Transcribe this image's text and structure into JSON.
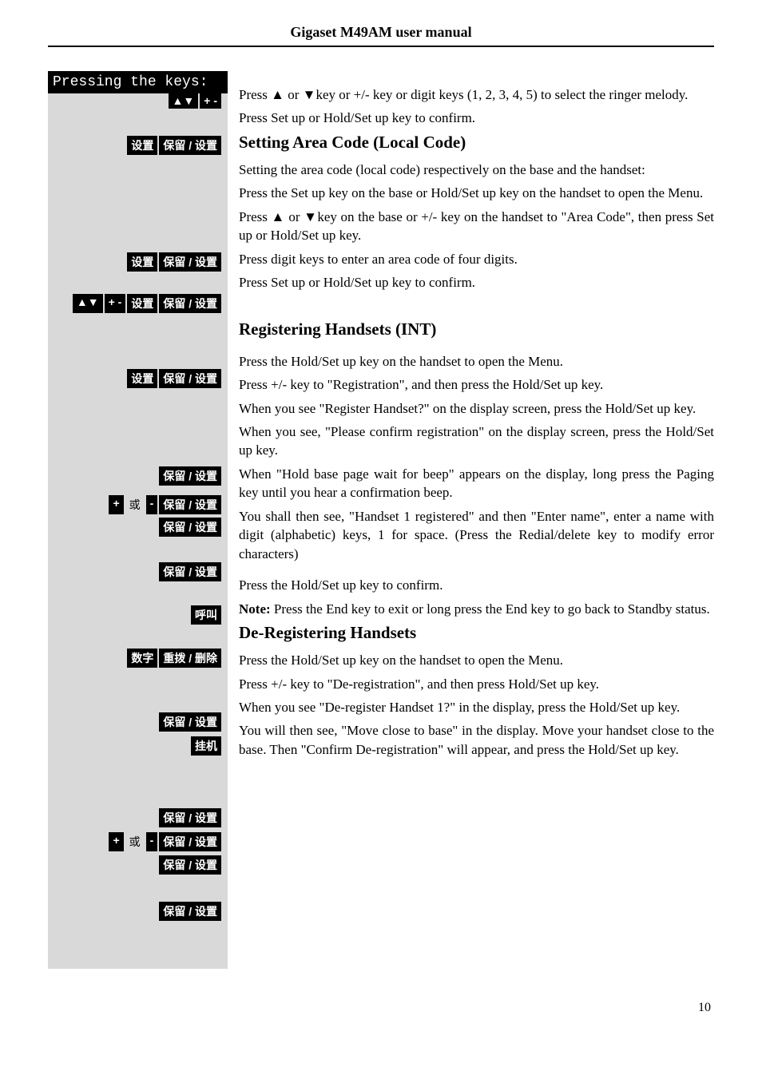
{
  "header": "Gigaset M49AM user manual",
  "page_number": "10",
  "sidebar": {
    "pressing_title": "Pressing the keys:",
    "btn_arrows_updown": "▲▼",
    "btn_plusminus": "+ -",
    "btn_shezhi": "设置",
    "btn_baoliu_shezhi": "保留 / 设置",
    "btn_plus": "+",
    "btn_huo": "或",
    "btn_minus": "-",
    "btn_huhao": "呼叫",
    "btn_shuzi": "数字",
    "btn_chongbo_shanchu": "重拨 / 删除",
    "btn_guaji": "挂机"
  },
  "s1": {
    "p1a": "Press  ▲  or  ▼key or +/- key or digit keys (1, 2, 3, 4, 5) to select the ringer melody.",
    "p2": "Press Set up or Hold/Set up key to confirm."
  },
  "s2": {
    "title": "Setting Area Code (Local Code)",
    "p1": "Setting the area code (local code) respectively on the base and the handset:",
    "p2": "Press the Set up key on the base or Hold/Set up key on the handset to open the Menu.",
    "p3": "Press  ▲  or  ▼key on the base or +/- key on the handset to \"Area Code\", then press Set up or Hold/Set up key.",
    "p4": "Press digit keys to enter an area code of four digits.",
    "p5": "Press Set up or Hold/Set up key to confirm."
  },
  "s3": {
    "title": "Registering Handsets (INT)",
    "p1": "Press the Hold/Set up key on the handset to open the Menu.",
    "p2": "Press +/- key to \"Registration\", and then press the Hold/Set up key.",
    "p3": "When you see \"Register Handset?\" on the display screen, press the Hold/Set up key.",
    "p4": "When you see, \"Please confirm registration\" on the display screen, press the Hold/Set up key.",
    "p5": "When \"Hold base page wait for beep\" appears on the display, long press the Paging key until you hear a confirmation beep.",
    "p6": "You shall then see, \"Handset 1 registered\" and then \"Enter name\", enter a name with digit (alphabetic) keys, 1 for space. (Press the Redial/delete key to modify error characters)",
    "p7": "Press the Hold/Set up key to confirm.",
    "p8a": "Note:",
    "p8b": " Press the End key to exit or long press the End key to go back to Standby status."
  },
  "s4": {
    "title": "De-Registering Handsets",
    "p1": "Press the Hold/Set up key on the handset to open the Menu.",
    "p2": "Press +/- key to \"De-registration\", and then press Hold/Set up key.",
    "p3": "When you see \"De-register Handset 1?\" in the display, press the Hold/Set up key.",
    "p4": "You will then see, \"Move close to base\" in the display. Move your handset close to the base. Then \"Confirm De-registration\" will appear, and press the Hold/Set up key."
  }
}
